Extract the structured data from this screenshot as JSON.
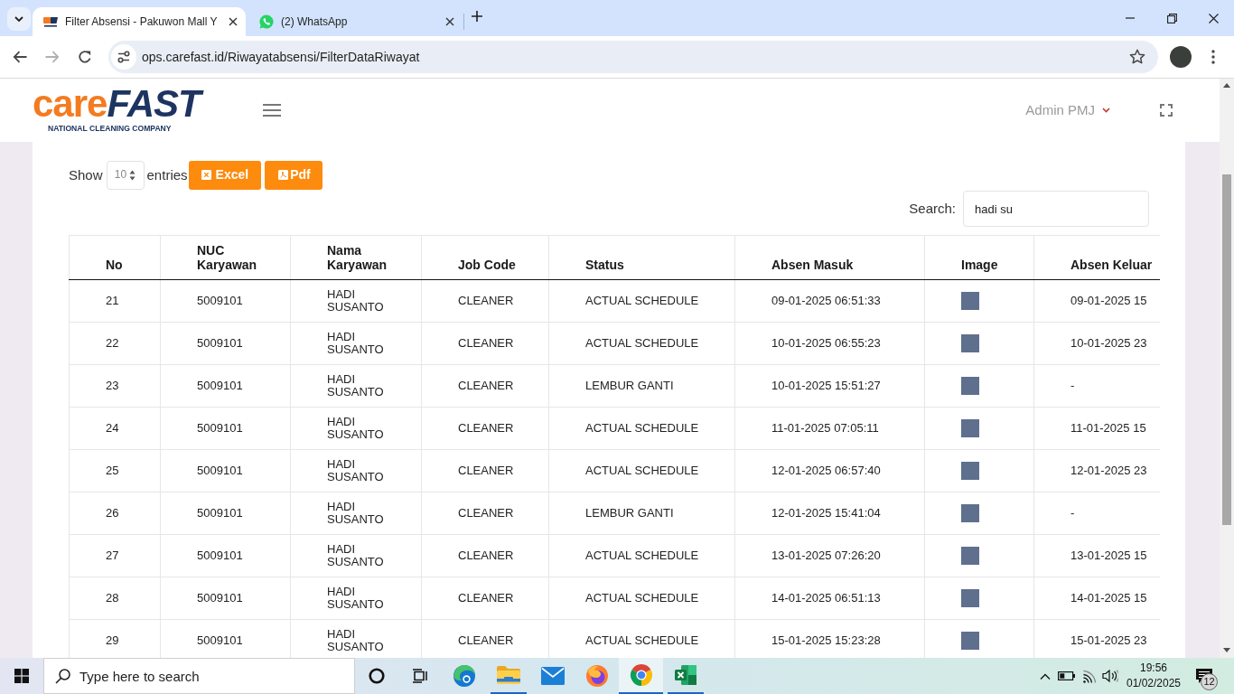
{
  "browser": {
    "tabs": [
      {
        "title": "Filter Absensi - Pakuwon Mall Y",
        "kind": "carefast",
        "selected": true
      },
      {
        "title": "(2) WhatsApp",
        "kind": "whatsapp",
        "selected": false
      }
    ],
    "back_disabled": false,
    "forward_disabled": true,
    "url": "ops.carefast.id/Riwayatabsensi/FilterDataRiwayat"
  },
  "header": {
    "logo": {
      "word_1": "care",
      "word_2": "FAST",
      "tagline": "NATIONAL CLEANING COMPANY"
    },
    "user": "Admin PMJ"
  },
  "table_controls": {
    "show_label": "Show",
    "page_length": "10",
    "entries_label": "entries",
    "export_buttons": [
      {
        "kind": "excel",
        "label": "Excel"
      },
      {
        "kind": "pdf",
        "label": "Pdf"
      }
    ],
    "search_label": "Search:",
    "search_value": "hadi su"
  },
  "table": {
    "columns": [
      "No",
      "NUC Karyawan",
      "Nama Karyawan",
      "Job Code",
      "Status",
      "Absen Masuk",
      "Image",
      "Absen Keluar"
    ],
    "rows": [
      {
        "no": "21",
        "nuc_karyawan": "5009101",
        "nama_karyawan": "HADI SUSANTO",
        "job_code": "CLEANER",
        "status": "ACTUAL SCHEDULE",
        "absen_masuk": "09-01-2025 06:51:33",
        "absen_keluar": "09-01-2025 15"
      },
      {
        "no": "22",
        "nuc_karyawan": "5009101",
        "nama_karyawan": "HADI SUSANTO",
        "job_code": "CLEANER",
        "status": "ACTUAL SCHEDULE",
        "absen_masuk": "10-01-2025 06:55:23",
        "absen_keluar": "10-01-2025 23"
      },
      {
        "no": "23",
        "nuc_karyawan": "5009101",
        "nama_karyawan": "HADI SUSANTO",
        "job_code": "CLEANER",
        "status": "LEMBUR GANTI",
        "absen_masuk": "10-01-2025 15:51:27",
        "absen_keluar": "-"
      },
      {
        "no": "24",
        "nuc_karyawan": "5009101",
        "nama_karyawan": "HADI SUSANTO",
        "job_code": "CLEANER",
        "status": "ACTUAL SCHEDULE",
        "absen_masuk": "11-01-2025 07:05:11",
        "absen_keluar": "11-01-2025 15"
      },
      {
        "no": "25",
        "nuc_karyawan": "5009101",
        "nama_karyawan": "HADI SUSANTO",
        "job_code": "CLEANER",
        "status": "ACTUAL SCHEDULE",
        "absen_masuk": "12-01-2025 06:57:40",
        "absen_keluar": "12-01-2025 23"
      },
      {
        "no": "26",
        "nuc_karyawan": "5009101",
        "nama_karyawan": "HADI SUSANTO",
        "job_code": "CLEANER",
        "status": "LEMBUR GANTI",
        "absen_masuk": "12-01-2025 15:41:04",
        "absen_keluar": "-"
      },
      {
        "no": "27",
        "nuc_karyawan": "5009101",
        "nama_karyawan": "HADI SUSANTO",
        "job_code": "CLEANER",
        "status": "ACTUAL SCHEDULE",
        "absen_masuk": "13-01-2025 07:26:20",
        "absen_keluar": "13-01-2025 15"
      },
      {
        "no": "28",
        "nuc_karyawan": "5009101",
        "nama_karyawan": "HADI SUSANTO",
        "job_code": "CLEANER",
        "status": "ACTUAL SCHEDULE",
        "absen_masuk": "14-01-2025 06:51:13",
        "absen_keluar": "14-01-2025 15"
      },
      {
        "no": "29",
        "nuc_karyawan": "5009101",
        "nama_karyawan": "HADI SUSANTO",
        "job_code": "CLEANER",
        "status": "ACTUAL SCHEDULE",
        "absen_masuk": "15-01-2025 15:23:28",
        "absen_keluar": "15-01-2025 23"
      }
    ]
  },
  "taskbar": {
    "search_placeholder": "Type here to search",
    "apps": [
      {
        "kind": "edge",
        "running": false,
        "selected": false
      },
      {
        "kind": "explorer",
        "running": true,
        "selected": false
      },
      {
        "kind": "mail",
        "running": false,
        "selected": false
      },
      {
        "kind": "firefox",
        "running": false,
        "selected": false
      },
      {
        "kind": "chrome",
        "running": true,
        "selected": true
      },
      {
        "kind": "excel",
        "running": true,
        "selected": false
      }
    ],
    "time": "19:56",
    "date": "01/02/2025",
    "notification_count": "12"
  }
}
